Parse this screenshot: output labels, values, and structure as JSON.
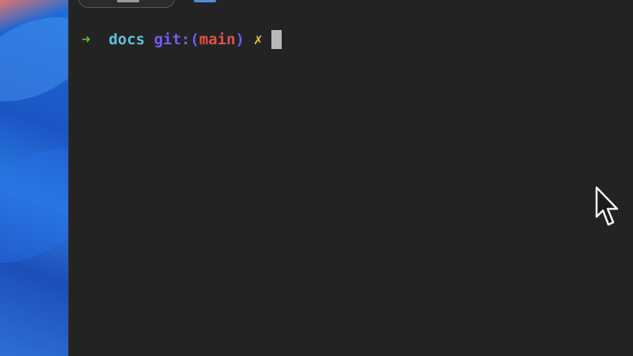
{
  "terminal": {
    "prompt": {
      "arrow": "➜",
      "directory": "docs",
      "git_label": "git:(",
      "branch": "main",
      "git_close": ")",
      "dirty_marker": "✗"
    }
  },
  "colors": {
    "background": "#232323",
    "arrow": "#6fb33a",
    "directory": "#5bc4d8",
    "git_label": "#6f5df2",
    "branch": "#e0524a",
    "dirty_marker": "#d9c04a",
    "cursor": "#b9b9b9"
  },
  "icons": {
    "pointer": "mouse-pointer-icon"
  }
}
